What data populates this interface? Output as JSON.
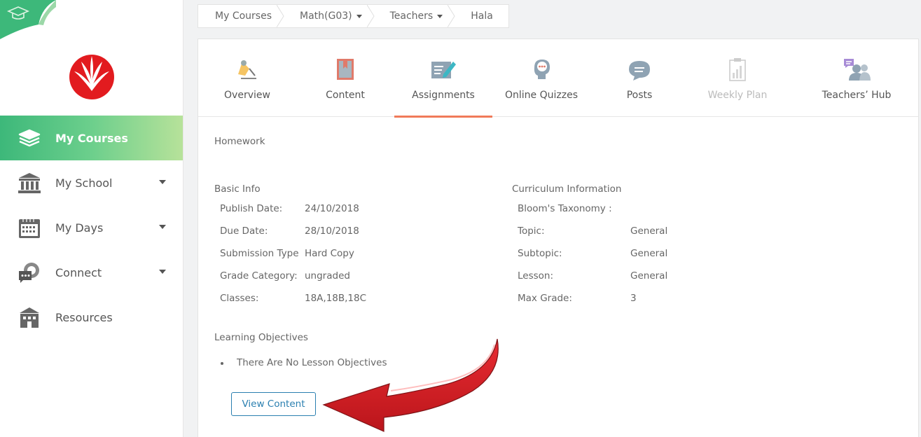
{
  "breadcrumb": [
    {
      "label": "My Courses",
      "dropdown": false
    },
    {
      "label": "Math(G03)",
      "dropdown": true
    },
    {
      "label": "Teachers",
      "dropdown": true
    },
    {
      "label": "Hala",
      "dropdown": false
    }
  ],
  "sidebar": {
    "items": [
      {
        "label": "My Courses",
        "icon": "books-stack-icon",
        "active": true,
        "dropdown": false
      },
      {
        "label": "My School",
        "icon": "school-building-icon",
        "active": false,
        "dropdown": true
      },
      {
        "label": "My Days",
        "icon": "calendar-icon",
        "active": false,
        "dropdown": true
      },
      {
        "label": "Connect",
        "icon": "chat-bubbles-icon",
        "active": false,
        "dropdown": true
      },
      {
        "label": "Resources",
        "icon": "library-building-icon",
        "active": false,
        "dropdown": false
      }
    ]
  },
  "tabs": [
    {
      "label": "Overview",
      "icon": "pen-tool-icon",
      "active": false,
      "disabled": false
    },
    {
      "label": "Content",
      "icon": "book-icon",
      "active": false,
      "disabled": false
    },
    {
      "label": "Assignments",
      "icon": "pen-paper-icon",
      "active": true,
      "disabled": false
    },
    {
      "label": "Online Quizzes",
      "icon": "head-thinking-icon",
      "active": false,
      "disabled": false
    },
    {
      "label": "Posts",
      "icon": "speech-bubble-icon",
      "active": false,
      "disabled": false
    },
    {
      "label": "Weekly Plan",
      "icon": "clipboard-chart-icon",
      "active": false,
      "disabled": true
    },
    {
      "label": "Teachers’ Hub",
      "icon": "people-chat-icon",
      "active": false,
      "disabled": false
    }
  ],
  "assignment": {
    "title": "Homework",
    "basic_info": {
      "heading": "Basic Info",
      "rows": [
        {
          "label": "Publish Date:",
          "value": "24/10/2018"
        },
        {
          "label": "Due Date:",
          "value": "28/10/2018"
        },
        {
          "label": "Submission Type",
          "value": "Hard Copy"
        },
        {
          "label": "Grade Category:",
          "value": "ungraded"
        },
        {
          "label": "Classes:",
          "value": "18A,18B,18C"
        }
      ]
    },
    "curriculum": {
      "heading": "Curriculum Information",
      "rows": [
        {
          "label": "Bloom's Taxonomy :",
          "value": ""
        },
        {
          "label": "Topic:",
          "value": "General"
        },
        {
          "label": "Subtopic:",
          "value": "General"
        },
        {
          "label": "Lesson:",
          "value": "General"
        },
        {
          "label": "Max Grade:",
          "value": "3"
        }
      ]
    },
    "objectives": {
      "heading": "Learning Objectives",
      "items": [
        "There Are No Lesson Objectives"
      ]
    },
    "view_button": "View Content"
  },
  "colors": {
    "accent_green": "#3db87a",
    "active_tab_underline": "#f07a5a",
    "button_blue": "#2a7fb0",
    "arrow_red": "#d8141b"
  }
}
